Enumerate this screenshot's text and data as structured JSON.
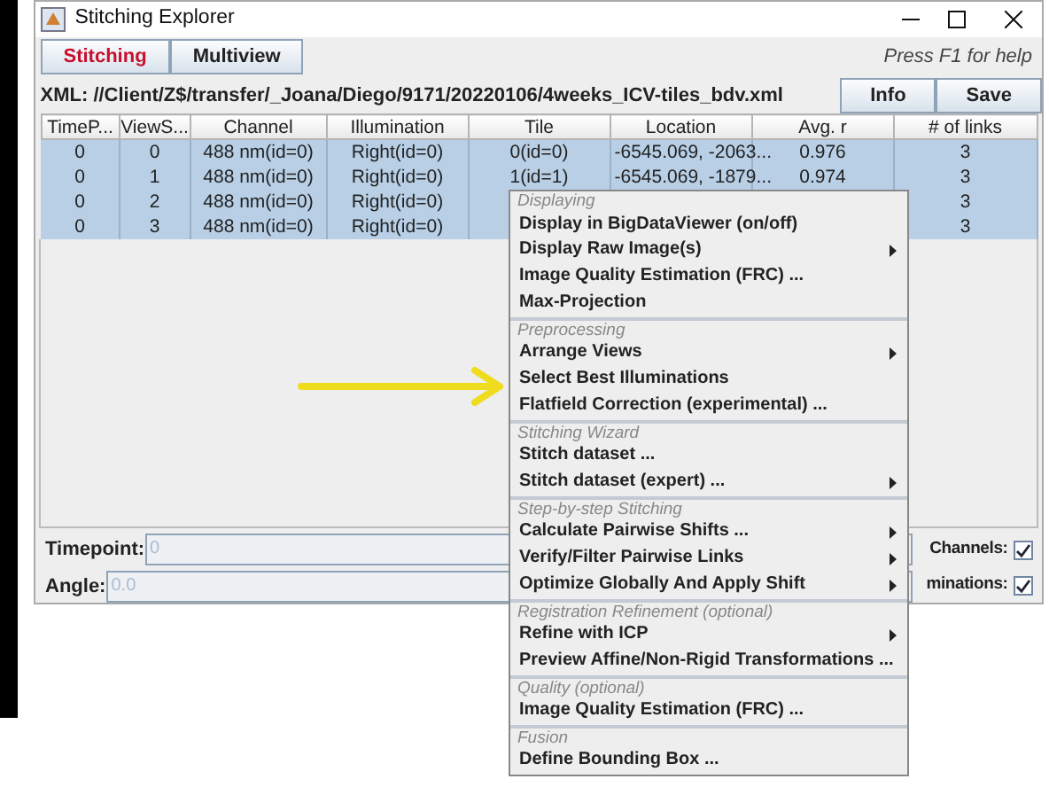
{
  "window": {
    "title": "Stitching Explorer"
  },
  "tabs": [
    {
      "label": "Stitching",
      "selected": true
    },
    {
      "label": "Multiview",
      "selected": false
    }
  ],
  "help_text": "Press F1 for help",
  "xml_path": "XML: //Client/Z$/transfer/_Joana/Diego/9171/20220106/4weeks_ICV-tiles_bdv.xml",
  "toolbar_buttons": [
    "Info",
    "Save"
  ],
  "table": {
    "columns": [
      "TimeP...",
      "ViewS...",
      "Channel",
      "Illumination",
      "Tile",
      "Location",
      "Avg. r",
      "# of links"
    ],
    "rows": [
      {
        "selected": true,
        "cells": [
          "0",
          "0",
          "488 nm(id=0)",
          "Right(id=0)",
          "0(id=0)",
          "-6545.069, -2063...",
          "0.976",
          "3"
        ]
      },
      {
        "selected": true,
        "cells": [
          "0",
          "1",
          "488 nm(id=0)",
          "Right(id=0)",
          "1(id=1)",
          "-6545.069, -1879...",
          "0.974",
          "3"
        ]
      },
      {
        "selected": true,
        "cells": [
          "0",
          "2",
          "488 nm(id=0)",
          "Right(id=0)",
          null,
          null,
          null,
          "3"
        ]
      },
      {
        "selected": true,
        "cells": [
          "0",
          "3",
          "488 nm(id=0)",
          "Right(id=0)",
          null,
          null,
          null,
          "3"
        ]
      }
    ]
  },
  "filters": [
    {
      "label": "Timepoint:",
      "value": "0"
    },
    {
      "label": "Angle:",
      "value": "0.0"
    }
  ],
  "toggles": [
    {
      "label": "Channels:",
      "checked": true
    },
    {
      "label": "minations:",
      "checked": true
    }
  ],
  "context_menu": [
    {
      "header": "Displaying",
      "items": [
        {
          "label": "Display in BigDataViewer (on/off)",
          "submenu": false
        },
        {
          "label": "Display Raw Image(s)",
          "submenu": true
        },
        {
          "label": "Image Quality Estimation (FRC) ...",
          "submenu": false
        },
        {
          "label": "Max-Projection",
          "submenu": false
        }
      ]
    },
    {
      "header": "Preprocessing",
      "items": [
        {
          "label": "Arrange Views",
          "submenu": true
        },
        {
          "label": "Select Best Illuminations",
          "submenu": false
        },
        {
          "label": "Flatfield Correction (experimental) ...",
          "submenu": false
        }
      ]
    },
    {
      "header": "Stitching Wizard",
      "items": [
        {
          "label": "Stitch dataset ...",
          "submenu": false
        },
        {
          "label": "Stitch dataset (expert) ...",
          "submenu": true
        }
      ]
    },
    {
      "header": "Step-by-step Stitching",
      "items": [
        {
          "label": "Calculate Pairwise Shifts ...",
          "submenu": true
        },
        {
          "label": "Verify/Filter Pairwise Links",
          "submenu": true
        },
        {
          "label": "Optimize Globally And Apply Shift",
          "submenu": true
        }
      ]
    },
    {
      "header": "Registration Refinement (optional)",
      "items": [
        {
          "label": "Refine with ICP",
          "submenu": true
        },
        {
          "label": "Preview Affine/Non-Rigid Transformations ...",
          "submenu": false
        }
      ]
    },
    {
      "header": "Quality (optional)",
      "items": [
        {
          "label": "Image Quality Estimation (FRC) ...",
          "submenu": false
        }
      ]
    },
    {
      "header": "Fusion",
      "items": [
        {
          "label": "Define Bounding Box ...",
          "submenu": false
        }
      ]
    }
  ]
}
